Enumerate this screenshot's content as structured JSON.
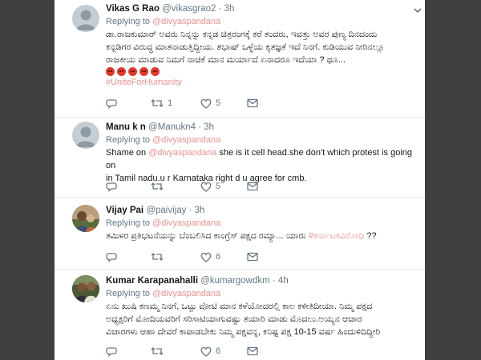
{
  "tweets": [
    {
      "name": "Vikas G Rao",
      "handle": "@vikasgrao2",
      "dot": "·",
      "time": "3h",
      "replying_label": "Replying to",
      "replying_to": "@divyaspandana",
      "text_lines": [
        "ಡಾ.ರಾಜಕುಮಾರ್ ಅವರು ನಿನ್ನನ್ನು ಕನ್ನಡ ಚಿತ್ರರಂಗಕ್ಕೆ ಕರೆ ತಂದರು, ಇವತ್ತು ಅವರ ಪುಣ್ಯ ದಿನದಂದು",
        "ಕನ್ನಡಿಗರ ವಿರುದ್ಧ ಮಾತನಾಡುತ್ತಿದ್ದೀಯ. ಶಭಾಷ್ ಒಳ್ಳೆಯ ಕೃತಜ್ಞತೆ ಇದೆ ನಿನಗೆ. ಕುಡಿಯುವ ನೀರಿನಲ್ಲೂ",
        "ರಾಜಕೀಯ ಮಾಡುವ ನಿಮಗೆ ನಾಚಿಕೆ ಮಾನ ಮರ್ಯಾದೆ ಏನಾದರೂ ಇದೆಯಾ ? ಥೂ..."
      ],
      "emoji_count": 5,
      "hashtag": "#UniteForHumanity",
      "retweets": "1",
      "likes": "5"
    },
    {
      "name": "Manu k n",
      "handle": "@Manukn4",
      "dot": "·",
      "time": "3h",
      "replying_label": "Replying to",
      "replying_to": "@divyaspandana",
      "text_prefix": "Shame on ",
      "text_mention": "@divyaspandana",
      "text_suffix": " she is it cell head.she don't which protest is going on",
      "text_line2": "in Tamil nadu.u r Karnataka right d u agree for cmb.",
      "retweets": "",
      "likes": "5"
    },
    {
      "name": "Vijay Pai",
      "handle": "@paivijay",
      "dot": "·",
      "time": "3h",
      "replying_label": "Replying to",
      "replying_to": "@divyaspandana",
      "text_prefix": "ತಮಿಳರ ಪ್ರತಿಭಟನೆಯನ್ನು ಬೆಂಬಲಿಸಿದ ಕಾಂಗ್ರೆಸ್ ಪಕ್ಷದ ರಮ್ಯಾ... ಯಾರು ",
      "text_hashtag": "#ಕರ್ನಾಟಕವಿರೋಧಿ",
      "text_suffix": " ??",
      "retweets": "",
      "likes": "6"
    },
    {
      "name": "Kumar Karapanahalli",
      "handle": "@kumargowdkm",
      "dot": "·",
      "time": "4h",
      "replying_label": "Replying to",
      "replying_to": "@divyaspandana",
      "text_lines": [
        "ಏನು ಖುಷಿ ಕಣಮ್ಮ ನಿನಗೆ, ಒಟ್ಟು ವೋಟಿ ಮಾನ ಕಳೆಯೋದರಲ್ಲಿ ಕಾಲ ಕಳೀತಿದೀಯಾ. ನಿಮ್ಮ ಪಕ್ಷದ",
        "ಅಧ್ಯಕ್ಷರಿಗೆ ಮೋದಿಯವರಿಗೆ ಸರಿಸಾಟಿಯಾಗುವಷ್ಟು ತಯಾರಿ ಮಾಡು ಮೊದಲು.ಅಯ್ಯನ ಆಚಾರ",
        "ವಿಚಾರಗಳು ಆಹಾ ದೇವರೆ ಕಾಪಾಡಬೇಕು ನಿಮ್ಮ ಪಕ್ಷವನ್ನ, ಕನಿಷ್ಟ ಪಕ್ಷ 10-15 ವರ್ಷ ಹಿಂದುಳಿದಿದ್ದೀರಿ"
      ],
      "retweets": "",
      "likes": "6"
    }
  ],
  "colors": {
    "accent": "#f0908f",
    "text": "#14171a",
    "meta": "#657786",
    "divider": "#e6ecf0",
    "frame": "#404040"
  },
  "icons": [
    "chevron-down-icon",
    "reply-icon",
    "retweet-icon",
    "like-icon",
    "message-icon",
    "default-avatar-icon"
  ]
}
